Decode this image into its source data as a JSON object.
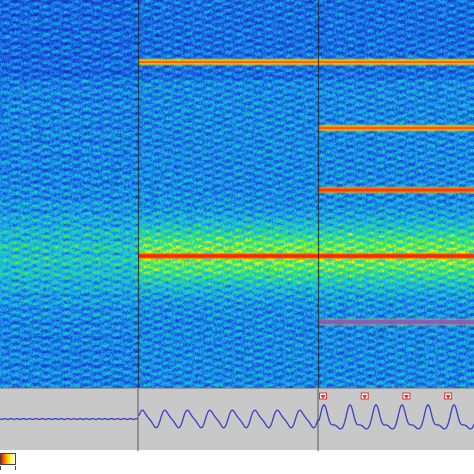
{
  "panels": [
    {
      "id": "panel-1",
      "tones": []
    },
    {
      "id": "panel-2",
      "tones": [
        {
          "freq_frac": 0.84,
          "color": "#ffd000"
        },
        {
          "freq_frac": 0.34,
          "color": "#ff3300"
        }
      ]
    },
    {
      "id": "panel-3",
      "tones": [
        {
          "freq_frac": 0.84,
          "color": "#ffd000"
        },
        {
          "freq_frac": 0.67,
          "color": "#ffb000"
        },
        {
          "freq_frac": 0.51,
          "color": "#ff6a00"
        },
        {
          "freq_frac": 0.34,
          "color": "#ff3300"
        },
        {
          "freq_frac": 0.17,
          "color": "#8a5cb8"
        }
      ]
    }
  ],
  "colors": {
    "background_low": "#1f4fd8",
    "background_mid": "#19b7e8",
    "energy_band": "#47ff18",
    "separator": "#222222",
    "waveform_trace": "#3a3fc8",
    "waveform_panel_bg": "#c8c8c8",
    "marker": "#e53030"
  },
  "waveform": {
    "panel_1_amplitude": 0.02,
    "panel_2_cycles": 8,
    "panel_3_cycles": 6,
    "panel_3_markers": 4
  },
  "colorbar": {
    "gradient": [
      "#ff0000",
      "#ff7a00",
      "#ffd400",
      "#ffff66",
      "#ffffff"
    ]
  }
}
